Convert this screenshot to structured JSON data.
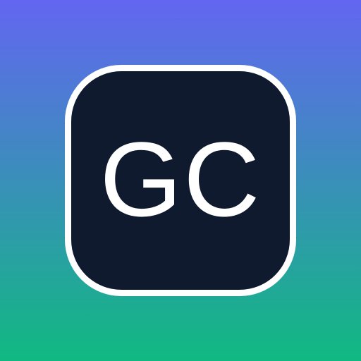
{
  "app_icon": {
    "monogram": "GC",
    "colors": {
      "gradient_top": "#6366F1",
      "gradient_bottom": "#10B981",
      "tile_background": "#0F1A2E",
      "tile_border": "#FFFFFF",
      "monogram_text": "#FFFFFF"
    }
  }
}
